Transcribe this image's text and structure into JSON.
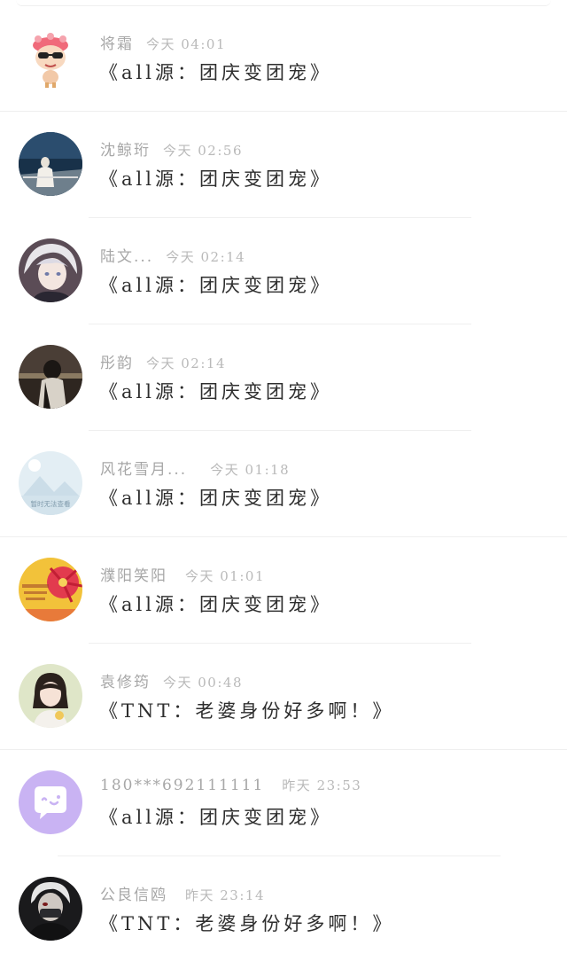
{
  "items": [
    {
      "name": "将霜",
      "time": "今天 04:01",
      "message": "《all源：团庆变团宠》",
      "avatar": "cartoon-sunglasses-icon"
    },
    {
      "name": "沈鲸珩",
      "time": "今天 02:56",
      "message": "《all源：团庆变团宠》",
      "avatar": "sea-photo-avatar"
    },
    {
      "name": "陆文...",
      "time": "今天 02:14",
      "message": "《all源：团庆变团宠》",
      "avatar": "anime-avatar"
    },
    {
      "name": "彤韵",
      "time": "今天 02:14",
      "message": "《all源：团庆变团宠》",
      "avatar": "dark-photo-avatar"
    },
    {
      "name": "风花雪月...",
      "time": "今天 01:18",
      "message": "《all源：团庆变团宠》",
      "avatar": "placeholder-image-avatar",
      "avatar_caption": "暂时无法查看"
    },
    {
      "name": "濮阳笑阳",
      "time": "今天 01:01",
      "message": "《all源：团庆变团宠》",
      "avatar": "red-flower-avatar"
    },
    {
      "name": "袁修筠",
      "time": "今天 00:48",
      "message": "《TNT：老婆身份好多啊！》",
      "avatar": "girl-photo-avatar"
    },
    {
      "name": "180***692111111",
      "time": "昨天 23:53",
      "message": "《all源：团庆变团宠》",
      "avatar": "chat-bubble-avatar"
    },
    {
      "name": "公良信鸥",
      "time": "昨天 23:14",
      "message": "《TNT：老婆身份好多啊！》",
      "avatar": "dark-character-avatar"
    }
  ],
  "colors": {
    "name": "#a7a7a7",
    "time": "#b9b9b9",
    "message": "#2e2e2e",
    "divider": "#efefef",
    "chat_bubble_bg": "#c9b3f3"
  }
}
